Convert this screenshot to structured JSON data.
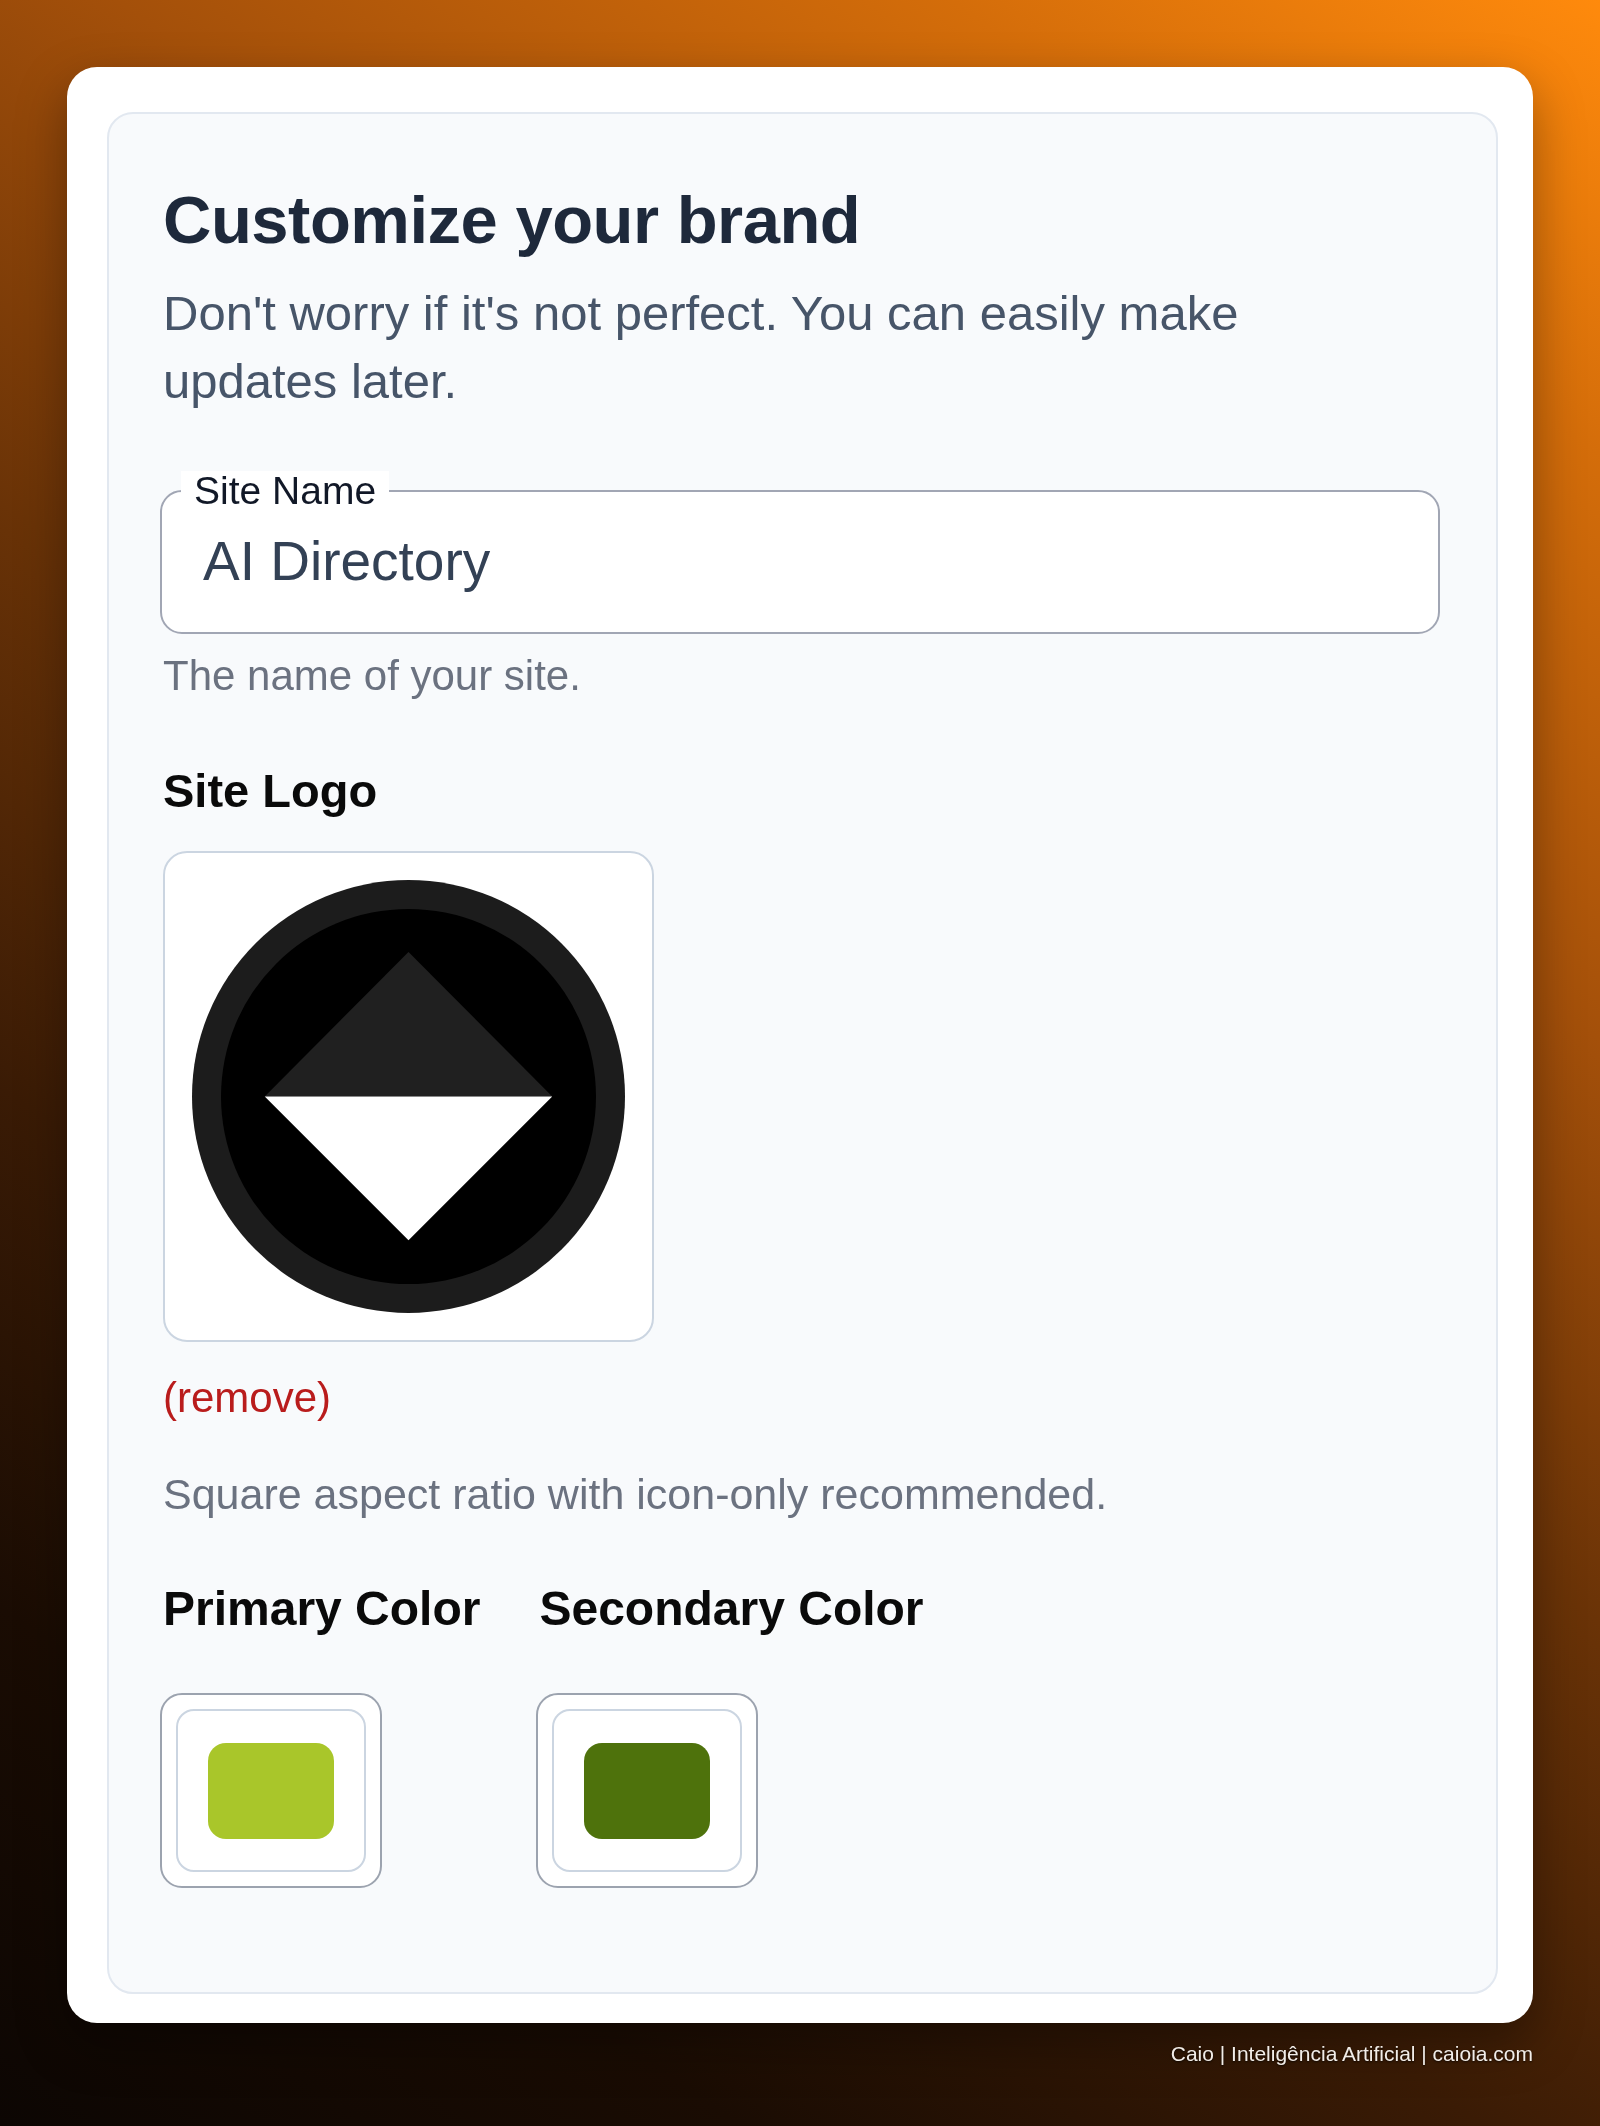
{
  "card": {
    "title": "Customize your brand",
    "subtitle": "Don't worry if it's not perfect. You can easily make updates later."
  },
  "site_name": {
    "label": "Site Name",
    "value": "AI Directory",
    "help": "The name of your site."
  },
  "site_logo": {
    "label": "Site Logo",
    "remove": "(remove)",
    "help": "Square aspect ratio with icon-only recommended."
  },
  "colors": [
    {
      "label": "Primary Color",
      "color": "#a9c62a"
    },
    {
      "label": "Secondary Color",
      "color": "#4e720c"
    }
  ],
  "footer": {
    "credit": "Caio | Inteligência Artificial | caioia.com"
  }
}
